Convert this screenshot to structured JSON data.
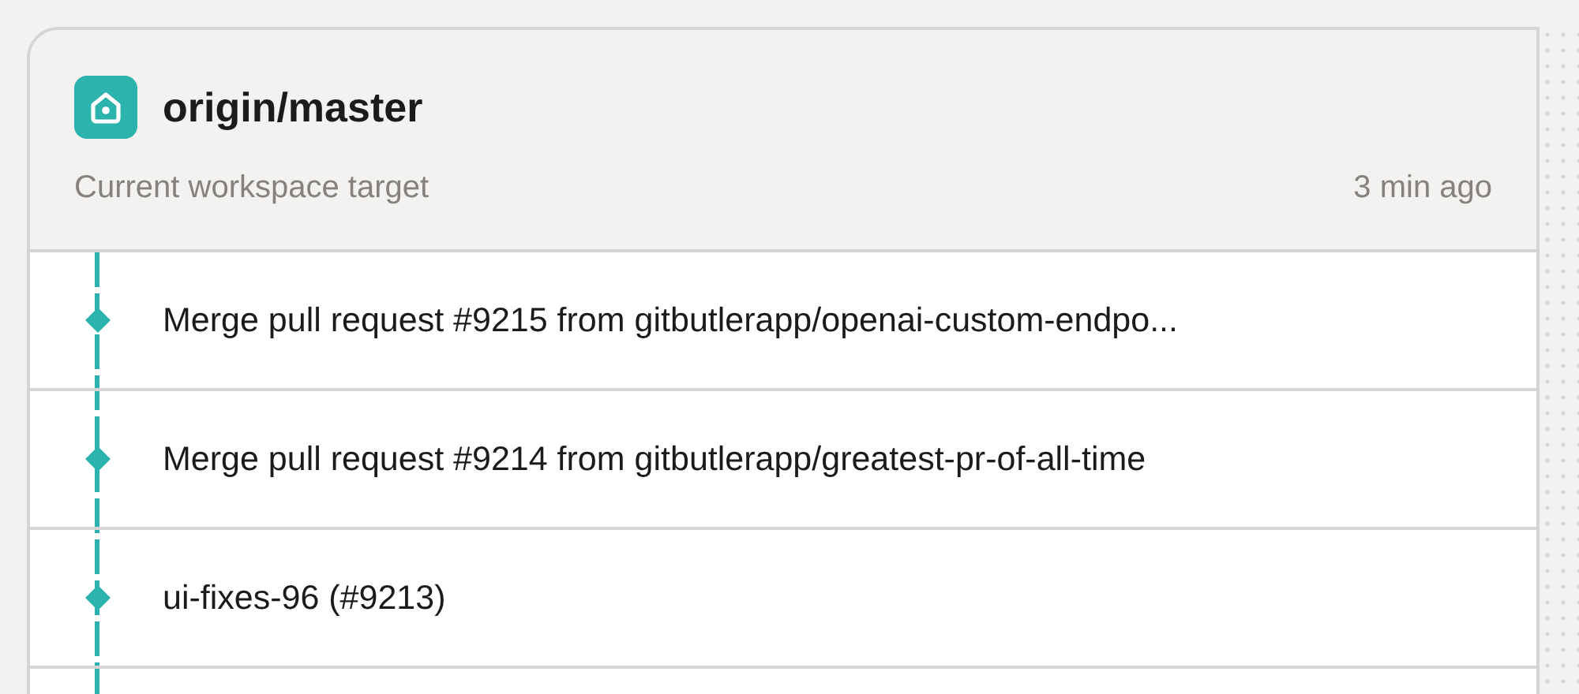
{
  "target": {
    "title": "origin/master",
    "subtitle": "Current workspace target",
    "time": "3 min ago"
  },
  "commits": [
    {
      "message": "Merge pull request #9215 from gitbutlerapp/openai-custom-endpo..."
    },
    {
      "message": "Merge pull request #9214 from gitbutlerapp/greatest-pr-of-all-time"
    },
    {
      "message": "ui-fixes-96 (#9213)"
    }
  ]
}
